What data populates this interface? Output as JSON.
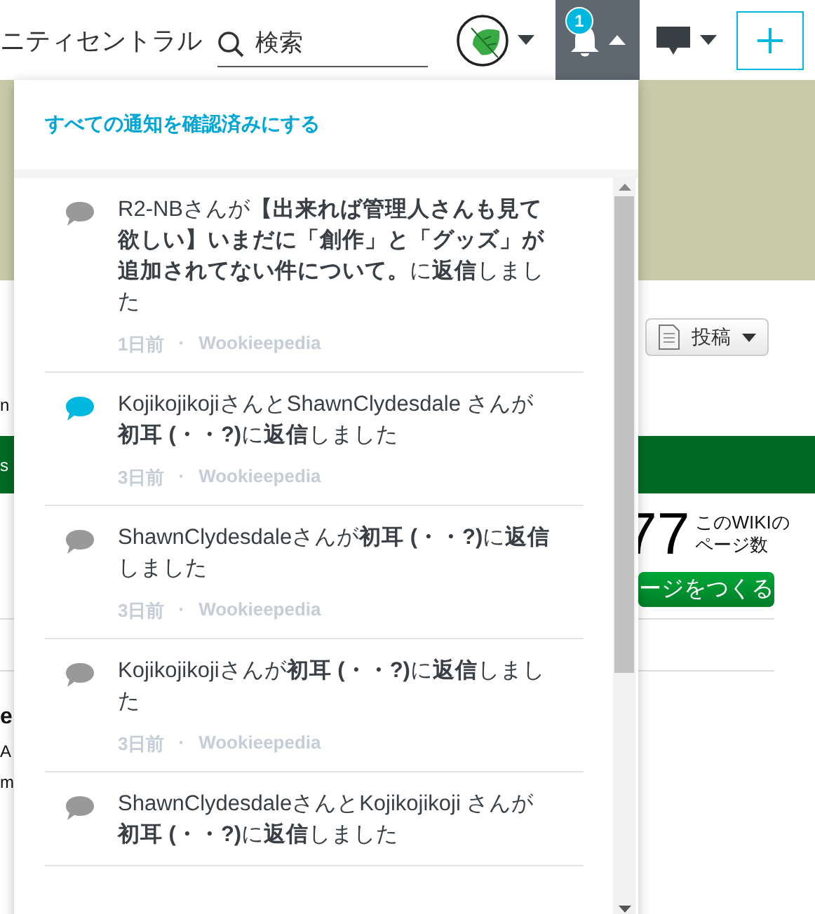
{
  "header": {
    "site_title": "ニティセントラル",
    "search": {
      "placeholder": "検索"
    },
    "notification_count": "1"
  },
  "notifications_panel": {
    "mark_all_read": "すべての通知を確認済みにする",
    "separator": "·",
    "items": [
      {
        "unread": false,
        "text": "R2-NBさんが**【出来れば管理人さんも見て欲しい】いまだに「創作」と「グッズ」が追加されてない件について。**に**返信**しました",
        "time": "1日前",
        "wiki": "Wookieepedia"
      },
      {
        "unread": true,
        "text": "KojikojikojiさんとShawnClydesdale さんが**初耳 (・・?)**に**返信**しました",
        "time": "3日前",
        "wiki": "Wookieepedia"
      },
      {
        "unread": false,
        "text": "ShawnClydesdaleさんが**初耳 (・・?)**に**返信**しました",
        "time": "3日前",
        "wiki": "Wookieepedia"
      },
      {
        "unread": false,
        "text": "Kojikojikojiさんが**初耳 (・・?)**に**返信**しました",
        "time": "3日前",
        "wiki": "Wookieepedia"
      },
      {
        "unread": false,
        "text": "ShawnClydesdaleさんとKojikojikoji さんが**初耳 (・・?)**に**返信**しました"
      }
    ]
  },
  "background_page": {
    "post_button": "投稿",
    "left_fragments": [
      "n",
      "s",
      "e",
      "A",
      "m"
    ],
    "page_count": "77",
    "page_count_label": [
      "このWIKIの",
      "ページ数"
    ],
    "create_page_button": "ージをつくる"
  }
}
